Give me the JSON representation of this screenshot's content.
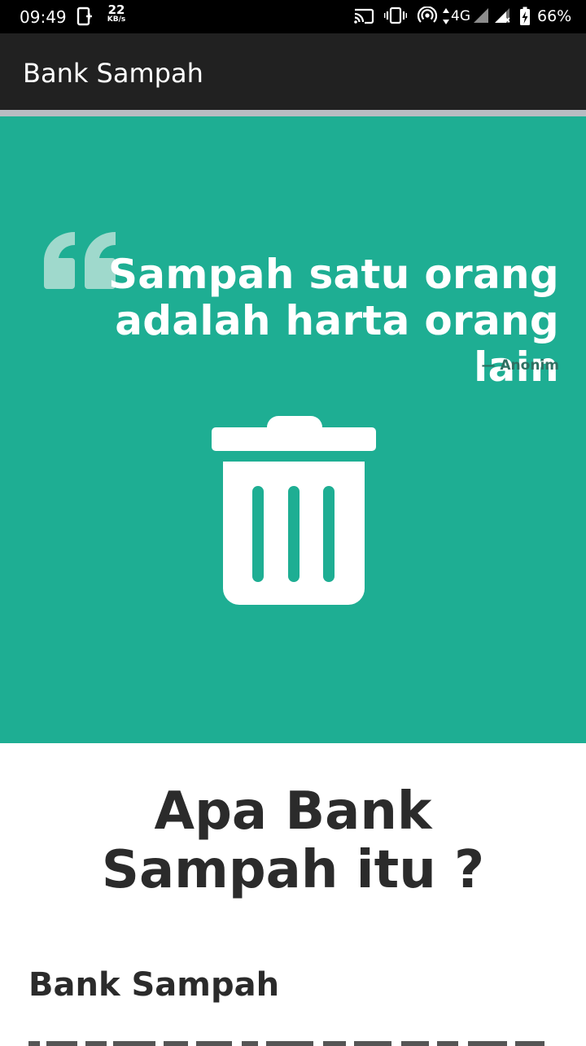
{
  "status_bar": {
    "time": "09:49",
    "net_speed_value": "22",
    "net_speed_unit": "KB/s",
    "network_type": "4G",
    "battery": "66%",
    "icons": [
      "sim-icon",
      "cast-icon",
      "vibrate-icon",
      "hotspot-icon",
      "signal-icon",
      "signal-x-icon",
      "battery-charging-icon"
    ]
  },
  "app_bar": {
    "title": "Bank Sampah"
  },
  "hero": {
    "background": "#1eae93",
    "quote": "Sampah satu orang adalah harta orang lain",
    "author": "— Anonim",
    "icons": [
      "quote-icon",
      "trash-icon"
    ]
  },
  "content": {
    "heading": "Apa Bank Sampah itu ?",
    "subheading": "Bank Sampah"
  }
}
